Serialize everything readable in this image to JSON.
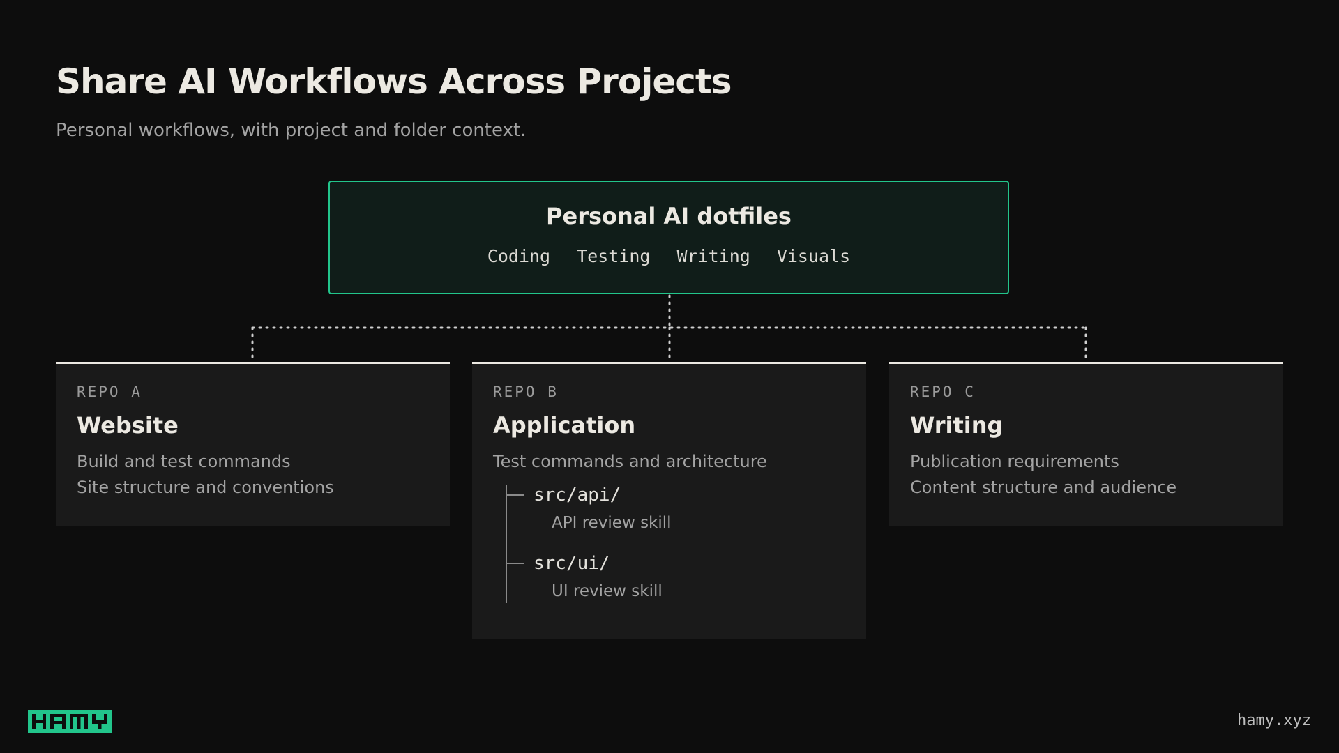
{
  "header": {
    "title": "Share AI Workflows Across Projects",
    "subtitle": "Personal workflows, with project and folder context."
  },
  "root": {
    "title": "Personal AI dotfiles",
    "tags": [
      "Coding",
      "Testing",
      "Writing",
      "Visuals"
    ]
  },
  "repos": [
    {
      "label": "REPO A",
      "title": "Website",
      "lines": [
        "Build and test commands",
        "Site structure and conventions"
      ]
    },
    {
      "label": "REPO B",
      "title": "Application",
      "lines": [
        "Test commands and architecture"
      ],
      "folders": [
        {
          "path": "src/api/",
          "skill": "API review skill"
        },
        {
          "path": "src/ui/",
          "skill": "UI review skill"
        }
      ]
    },
    {
      "label": "REPO C",
      "title": "Writing",
      "lines": [
        "Publication requirements",
        "Content structure and audience"
      ]
    }
  ],
  "footer": {
    "logo": "HAMY",
    "site": "hamy.xyz"
  },
  "colors": {
    "background": "#0d0d0d",
    "accent": "#22c58b",
    "root_fill": "#101d19",
    "card_fill": "#1a1a1a"
  }
}
